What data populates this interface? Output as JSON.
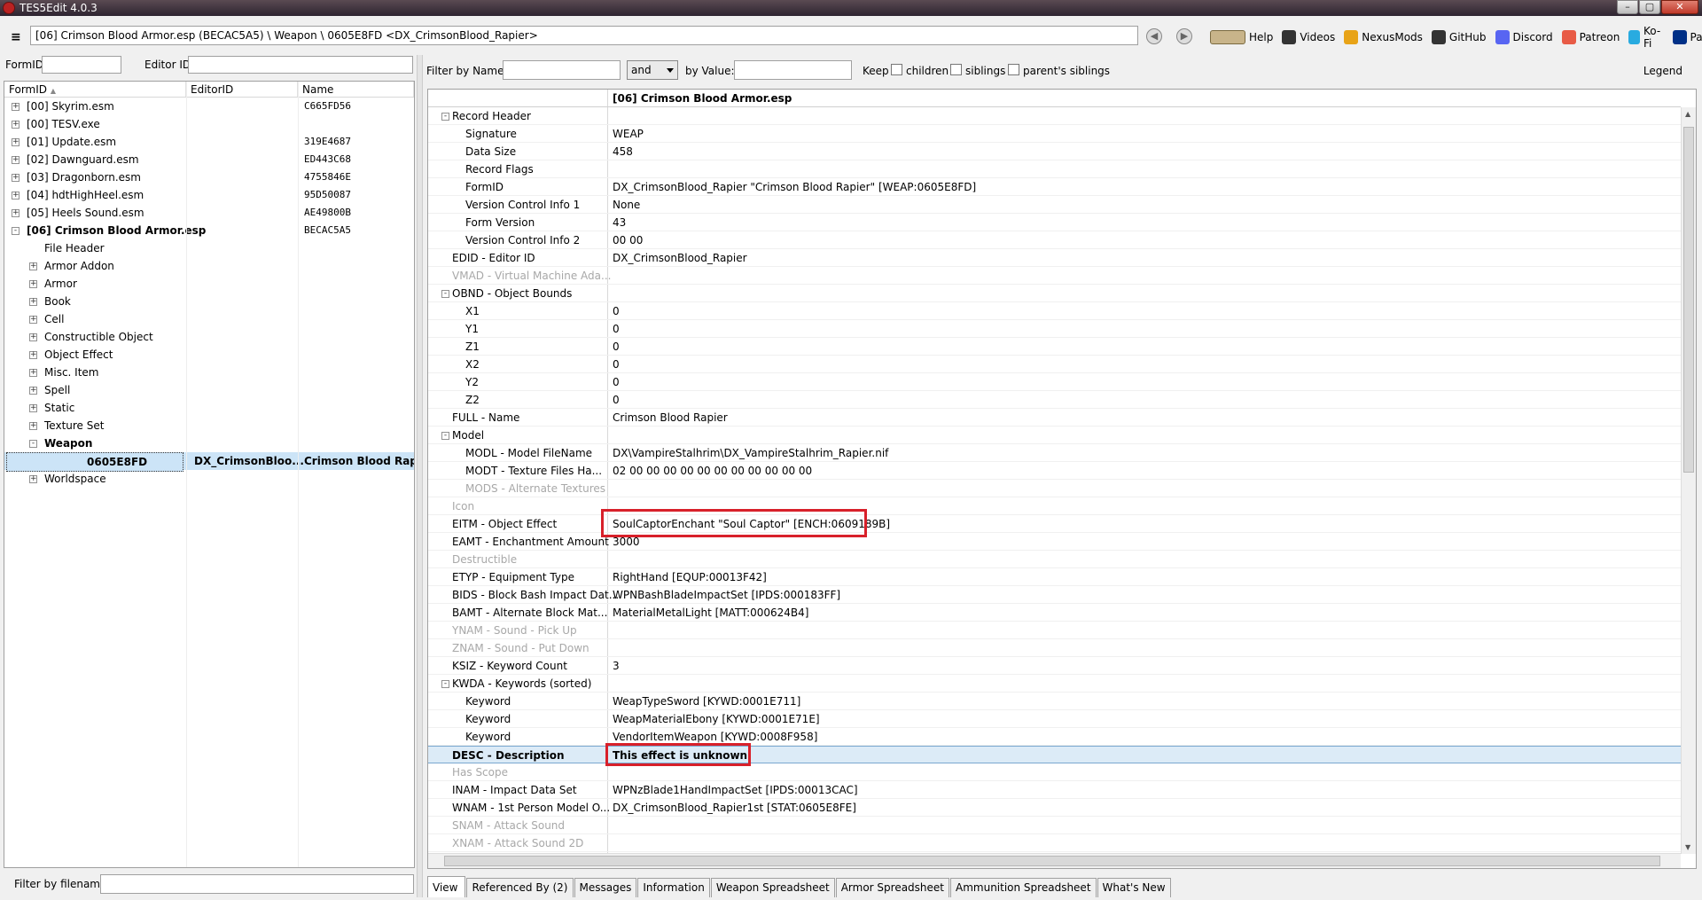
{
  "window": {
    "title": "TES5Edit 4.0.3",
    "buttons": [
      "–",
      "▢",
      "✕"
    ]
  },
  "toolbar": {
    "menu_icon": "≡",
    "path": "[06] Crimson Blood Armor.esp (BECAC5A5) \\ Weapon \\ 0605E8FD <DX_CrimsonBlood_Rapier>",
    "back_glyph": "◀",
    "forward_glyph": "▶",
    "links": [
      {
        "label": "Help",
        "icon": "book-icon",
        "color": "#c8b48a"
      },
      {
        "label": "Videos",
        "icon": "gp-icon",
        "color": "#333333"
      },
      {
        "label": "NexusMods",
        "icon": "nexus-icon",
        "color": "#e8a317"
      },
      {
        "label": "GitHub",
        "icon": "github-icon",
        "color": "#333333"
      },
      {
        "label": "Discord",
        "icon": "discord-icon",
        "color": "#5865f2"
      },
      {
        "label": "Patreon",
        "icon": "patreon-icon",
        "color": "#e85b46"
      },
      {
        "label": "Ko-Fi",
        "icon": "kofi-icon",
        "color": "#29abe0"
      },
      {
        "label": "PayPal",
        "icon": "paypal-icon",
        "color": "#003087"
      }
    ]
  },
  "left": {
    "formid_label": "FormID",
    "editorid_label": "Editor ID",
    "columns": [
      "FormID",
      "EditorID",
      "Name"
    ],
    "sort_glyph": "▲",
    "tree": [
      {
        "indent": 0,
        "exp": "+",
        "label": "[00] Skyrim.esm",
        "editor": "",
        "name": "C665FD56"
      },
      {
        "indent": 0,
        "exp": "+",
        "label": "[00] TESV.exe",
        "editor": "",
        "name": ""
      },
      {
        "indent": 0,
        "exp": "+",
        "label": "[01] Update.esm",
        "editor": "",
        "name": "319E4687"
      },
      {
        "indent": 0,
        "exp": "+",
        "label": "[02] Dawnguard.esm",
        "editor": "",
        "name": "ED443C68"
      },
      {
        "indent": 0,
        "exp": "+",
        "label": "[03] Dragonborn.esm",
        "editor": "",
        "name": "4755846E"
      },
      {
        "indent": 0,
        "exp": "+",
        "label": "[04] hdtHighHeel.esm",
        "editor": "",
        "name": "95D50087"
      },
      {
        "indent": 0,
        "exp": "+",
        "label": "[05] Heels Sound.esm",
        "editor": "",
        "name": "AE49800B"
      },
      {
        "indent": 0,
        "exp": "-",
        "label": "[06] Crimson Blood Armor.esp",
        "editor": "",
        "name": "BECAC5A5",
        "bold": true
      },
      {
        "indent": 1,
        "exp": "",
        "label": "File Header",
        "editor": "",
        "name": ""
      },
      {
        "indent": 1,
        "exp": "+",
        "label": "Armor Addon",
        "editor": "",
        "name": ""
      },
      {
        "indent": 1,
        "exp": "+",
        "label": "Armor",
        "editor": "",
        "name": ""
      },
      {
        "indent": 1,
        "exp": "+",
        "label": "Book",
        "editor": "",
        "name": ""
      },
      {
        "indent": 1,
        "exp": "+",
        "label": "Cell",
        "editor": "",
        "name": ""
      },
      {
        "indent": 1,
        "exp": "+",
        "label": "Constructible Object",
        "editor": "",
        "name": ""
      },
      {
        "indent": 1,
        "exp": "+",
        "label": "Object Effect",
        "editor": "",
        "name": ""
      },
      {
        "indent": 1,
        "exp": "+",
        "label": "Misc. Item",
        "editor": "",
        "name": ""
      },
      {
        "indent": 1,
        "exp": "+",
        "label": "Spell",
        "editor": "",
        "name": ""
      },
      {
        "indent": 1,
        "exp": "+",
        "label": "Static",
        "editor": "",
        "name": ""
      },
      {
        "indent": 1,
        "exp": "+",
        "label": "Texture Set",
        "editor": "",
        "name": ""
      },
      {
        "indent": 1,
        "exp": "-",
        "label": "Weapon",
        "editor": "",
        "name": "",
        "bold": true
      },
      {
        "indent": 2,
        "exp": "",
        "label": "0605E8FD",
        "editor": "DX_CrimsonBloo...",
        "name": "Crimson Blood Rapi...",
        "selected": true
      },
      {
        "indent": 1,
        "exp": "+",
        "label": "Worldspace",
        "editor": "",
        "name": ""
      }
    ],
    "filter_label": "Filter by filename:"
  },
  "filter": {
    "name_label": "Filter by Name:",
    "op_value": "and",
    "value_label": "by Value:",
    "keep_label": "Keep",
    "children_label": "children",
    "siblings_label": "siblings",
    "parents_label": "parent's siblings",
    "legend_label": "Legend"
  },
  "record": {
    "header": "[06] Crimson Blood Armor.esp",
    "rows": [
      {
        "level": 0,
        "exp": "-",
        "label": "Record Header",
        "value": ""
      },
      {
        "level": 1,
        "label": "Signature",
        "value": "WEAP"
      },
      {
        "level": 1,
        "label": "Data Size",
        "value": "458"
      },
      {
        "level": 1,
        "label": "Record Flags",
        "value": ""
      },
      {
        "level": 1,
        "label": "FormID",
        "value": "DX_CrimsonBlood_Rapier \"Crimson Blood Rapier\" [WEAP:0605E8FD]"
      },
      {
        "level": 1,
        "label": "Version Control Info 1",
        "value": "None"
      },
      {
        "level": 1,
        "label": "Form Version",
        "value": "43"
      },
      {
        "level": 1,
        "label": "Version Control Info 2",
        "value": "00 00"
      },
      {
        "level": 0,
        "label": "EDID - Editor ID",
        "value": "DX_CrimsonBlood_Rapier"
      },
      {
        "level": 0,
        "label": "VMAD - Virtual Machine Ada...",
        "value": "",
        "gray": true
      },
      {
        "level": 0,
        "exp": "-",
        "label": "OBND - Object Bounds",
        "value": ""
      },
      {
        "level": 1,
        "label": "X1",
        "value": "0"
      },
      {
        "level": 1,
        "label": "Y1",
        "value": "0"
      },
      {
        "level": 1,
        "label": "Z1",
        "value": "0"
      },
      {
        "level": 1,
        "label": "X2",
        "value": "0"
      },
      {
        "level": 1,
        "label": "Y2",
        "value": "0"
      },
      {
        "level": 1,
        "label": "Z2",
        "value": "0"
      },
      {
        "level": 0,
        "label": "FULL - Name",
        "value": "Crimson Blood Rapier"
      },
      {
        "level": 0,
        "exp": "-",
        "label": "Model",
        "value": ""
      },
      {
        "level": 1,
        "label": "MODL - Model FileName",
        "value": "DX\\VampireStalhrim\\DX_VampireStalhrim_Rapier.nif"
      },
      {
        "level": 1,
        "label": "MODT - Texture Files Ha...",
        "value": "02 00 00 00 00 00 00 00 00 00 00 00"
      },
      {
        "level": 1,
        "label": "MODS - Alternate Textures",
        "value": "",
        "gray": true
      },
      {
        "level": 0,
        "label": "Icon",
        "value": "",
        "gray": true
      },
      {
        "level": 0,
        "label": "EITM - Object Effect",
        "value": "SoulCaptorEnchant \"Soul Captor\" [ENCH:0609189B]",
        "boxed": true
      },
      {
        "level": 0,
        "label": "EAMT - Enchantment Amount",
        "value": "3000"
      },
      {
        "level": 0,
        "label": "Destructible",
        "value": "",
        "gray": true
      },
      {
        "level": 0,
        "label": "ETYP - Equipment Type",
        "value": "RightHand [EQUP:00013F42]"
      },
      {
        "level": 0,
        "label": "BIDS - Block Bash Impact Dat...",
        "value": "WPNBashBladeImpactSet [IPDS:000183FF]"
      },
      {
        "level": 0,
        "label": "BAMT - Alternate Block Mat...",
        "value": "MaterialMetalLight [MATT:000624B4]"
      },
      {
        "level": 0,
        "label": "YNAM - Sound - Pick Up",
        "value": "",
        "gray": true
      },
      {
        "level": 0,
        "label": "ZNAM - Sound - Put Down",
        "value": "",
        "gray": true
      },
      {
        "level": 0,
        "label": "KSIZ - Keyword Count",
        "value": "3"
      },
      {
        "level": 0,
        "exp": "-",
        "label": "KWDA - Keywords (sorted)",
        "value": ""
      },
      {
        "level": 1,
        "label": "Keyword",
        "value": "WeapTypeSword [KYWD:0001E711]"
      },
      {
        "level": 1,
        "label": "Keyword",
        "value": "WeapMaterialEbony [KYWD:0001E71E]"
      },
      {
        "level": 1,
        "label": "Keyword",
        "value": "VendorItemWeapon [KYWD:0008F958]"
      },
      {
        "level": 0,
        "label": "DESC - Description",
        "value": "This effect is unknown",
        "highlight": true,
        "boxed": true
      },
      {
        "level": 0,
        "label": "Has Scope",
        "value": "",
        "gray": true
      },
      {
        "level": 0,
        "label": "INAM - Impact Data Set",
        "value": "WPNzBlade1HandImpactSet [IPDS:00013CAC]"
      },
      {
        "level": 0,
        "label": "WNAM - 1st Person Model O...",
        "value": "DX_CrimsonBlood_Rapier1st [STAT:0605E8FE]"
      },
      {
        "level": 0,
        "label": "SNAM - Attack Sound",
        "value": "",
        "gray": true
      },
      {
        "level": 0,
        "label": "XNAM - Attack Sound 2D",
        "value": "",
        "gray": true
      }
    ]
  },
  "tabs": [
    "View",
    "Referenced By (2)",
    "Messages",
    "Information",
    "Weapon Spreadsheet",
    "Armor Spreadsheet",
    "Ammunition Spreadsheet",
    "What's New"
  ],
  "colors": {
    "highlight_box": "#d8202a",
    "selection": "#cce4f7"
  }
}
